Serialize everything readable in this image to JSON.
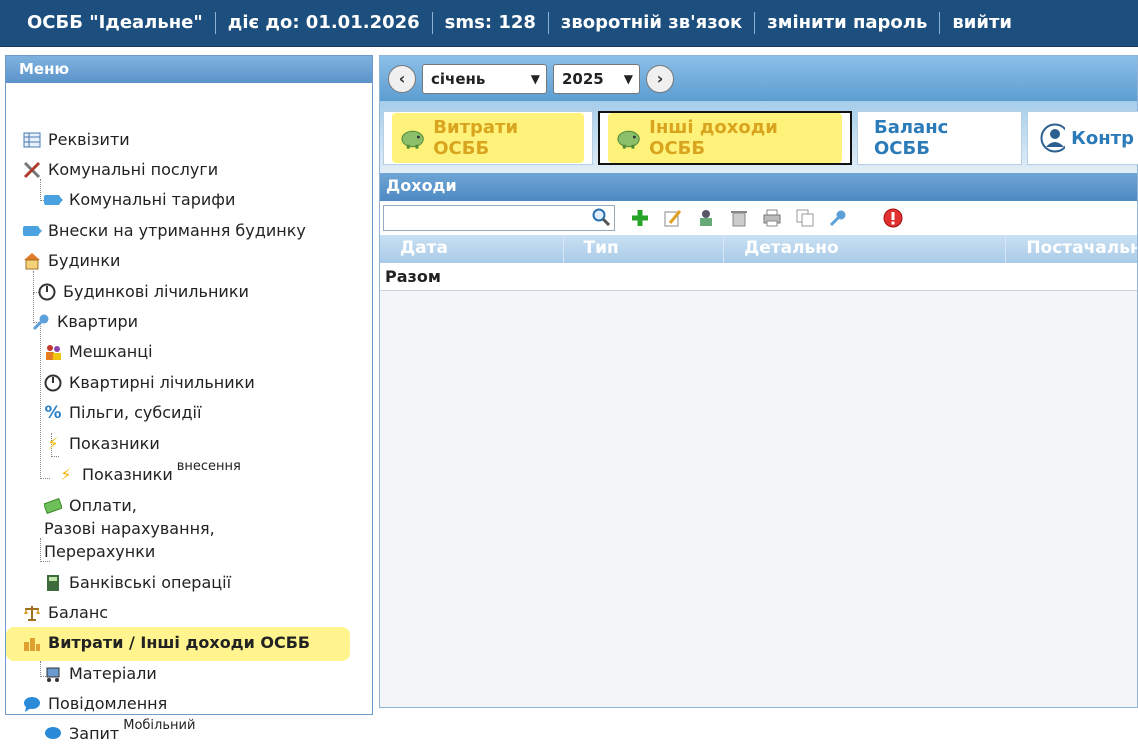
{
  "topbar": {
    "org": "ОСББ \"Ідеальне\"",
    "valid_until": "діє до: 01.01.2026",
    "sms": "sms: 128",
    "feedback": "зворотній зв'язок",
    "change_password": "змінити пароль",
    "logout": "вийти"
  },
  "sidebar": {
    "title": "Меню",
    "items": {
      "rekvizyty": "Реквізити",
      "komunalni_posluhy": "Комунальні послуги",
      "komunalni_taryfy": "Комунальні тарифи",
      "vnesky": "Внески на утримання будинку",
      "budynky": "Будинки",
      "budynkovi_lich": "Будинкові лічильники",
      "kvartyry": "Квартири",
      "meshkantsi": "Мешканці",
      "kvartyrni_lich": "Квартирні лічильники",
      "pilhy": "Пільги, субсидії",
      "pokaznyky": "Показники",
      "pokaznyky2": "Показники",
      "pokaznyky2_sup": "внесення",
      "oplaty_1": "Оплати,",
      "oplaty_2": "Разові нарахування,",
      "oplaty_3": "Перерахунки",
      "bank": "Банківські операції",
      "balans": "Баланс",
      "vytraty": "Витрати / Інші доходи ОСББ",
      "materialy": "Матеріали",
      "povidomlennia": "Повідомлення",
      "zapyt": "Запит",
      "zapyt_sup": "Мобільний"
    }
  },
  "period": {
    "month": "січень",
    "year": "2025"
  },
  "tabs": {
    "expenses": "Витрати ОСББ",
    "other_income": "Інші доходи ОСББ",
    "balance": "Баланс ОСББ",
    "contractors": "Контр"
  },
  "section": {
    "title": "Доходи"
  },
  "search": {
    "value": ""
  },
  "grid": {
    "columns": [
      "Дата",
      "Тип",
      "Детально",
      "Постачальн"
    ],
    "total_label": "Разом"
  },
  "colors": {
    "topbar": "#1d4f7e",
    "highlight": "#fff27a",
    "tab_text": "#2b7bb9"
  }
}
